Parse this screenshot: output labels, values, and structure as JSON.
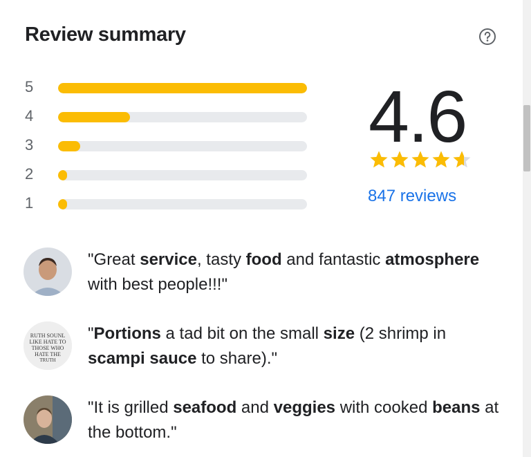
{
  "header": {
    "title": "Review summary",
    "help_icon": "question-circle-icon"
  },
  "distribution": [
    {
      "stars": "5",
      "fraction": 1.0
    },
    {
      "stars": "4",
      "fraction": 0.29
    },
    {
      "stars": "3",
      "fraction": 0.09
    },
    {
      "stars": "2",
      "fraction": 0.02
    },
    {
      "stars": "1",
      "fraction": 0.02
    }
  ],
  "score": {
    "value": "4.6",
    "stars_filled": 4.6,
    "reviews_link": "847 reviews"
  },
  "snippets": [
    {
      "avatar": "person-avatar",
      "parts": [
        {
          "t": "\"Great ",
          "b": false
        },
        {
          "t": "service",
          "b": true
        },
        {
          "t": ", tasty ",
          "b": false
        },
        {
          "t": "food",
          "b": true
        },
        {
          "t": " and fantastic ",
          "b": false
        },
        {
          "t": "atmosphere",
          "b": true
        },
        {
          "t": " with best people!!!\"",
          "b": false
        }
      ]
    },
    {
      "avatar": "text-image-avatar",
      "avatar_text": "RUTH SOUNL LIKE HATE TO THOSE WHO HATE THE TRUTH",
      "parts": [
        {
          "t": "\"",
          "b": false
        },
        {
          "t": "Portions",
          "b": true
        },
        {
          "t": " a tad bit on the small ",
          "b": false
        },
        {
          "t": "size",
          "b": true
        },
        {
          "t": " (2 shrimp in ",
          "b": false
        },
        {
          "t": "scampi sauce",
          "b": true
        },
        {
          "t": " to share).\"",
          "b": false
        }
      ]
    },
    {
      "avatar": "person-avatar",
      "parts": [
        {
          "t": "\"It is grilled ",
          "b": false
        },
        {
          "t": "seafood",
          "b": true
        },
        {
          "t": " and ",
          "b": false
        },
        {
          "t": "veggies",
          "b": true
        },
        {
          "t": " with cooked ",
          "b": false
        },
        {
          "t": "beans",
          "b": true
        },
        {
          "t": " at the bottom.\"",
          "b": false
        }
      ]
    }
  ],
  "colors": {
    "star": "#fbbc04",
    "star_empty": "#dadce0",
    "link": "#1a73e8",
    "bar_track": "#e8eaed"
  }
}
